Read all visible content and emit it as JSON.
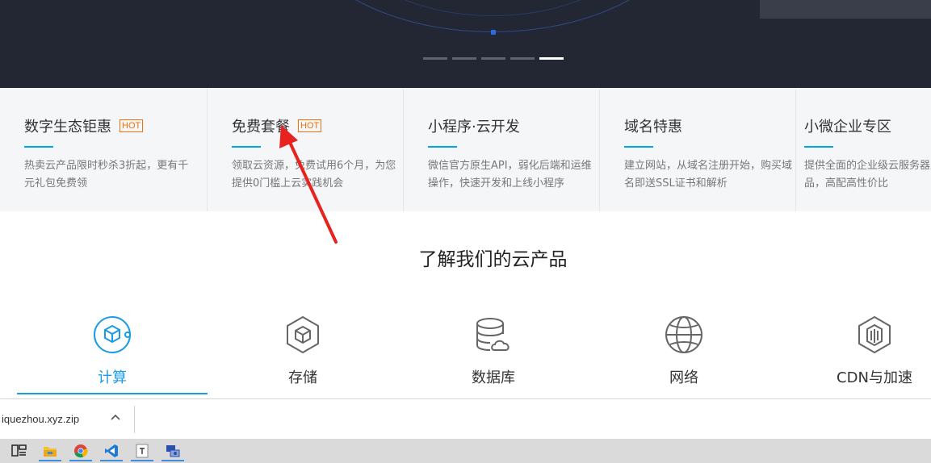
{
  "promo_cards": [
    {
      "title": "数字生态钜惠",
      "badge": "HOT",
      "desc": "热卖云产品限时秒杀3折起，更有千元礼包免费领"
    },
    {
      "title": "免费套餐",
      "badge": "HOT",
      "desc": "领取云资源，免费试用6个月，为您提供0门槛上云实践机会"
    },
    {
      "title": "小程序·云开发",
      "badge": "",
      "desc": "微信官方原生API，弱化后端和运维操作，快速开发和上线小程序"
    },
    {
      "title": "域名特惠",
      "badge": "",
      "desc": "建立网站，从域名注册开始，购买域名即送SSL证书和解析"
    },
    {
      "title": "小微企业专区",
      "badge": "",
      "desc": "提供全面的企业级云服务器及产品，高配高性价比"
    }
  ],
  "section": {
    "title": "了解我们的云产品"
  },
  "products": [
    {
      "label": "计算",
      "icon": "compute-icon",
      "active": true
    },
    {
      "label": "存储",
      "icon": "storage-icon",
      "active": false
    },
    {
      "label": "数据库",
      "icon": "database-icon",
      "active": false
    },
    {
      "label": "网络",
      "icon": "network-icon",
      "active": false
    },
    {
      "label": "CDN与加速",
      "icon": "cdn-icon",
      "active": false
    }
  ],
  "download_bar": {
    "filename": "iquezhou.xyz.zip"
  },
  "carousel": {
    "count": 5,
    "active_index": 4
  },
  "colors": {
    "accent": "#1a9be6",
    "hot": "#f56e0a",
    "banner_bg": "#232733",
    "annotation": "#e8231f"
  },
  "taskbar": {
    "items": [
      "task-view-icon",
      "file-explorer-icon",
      "chrome-icon",
      "vscode-icon",
      "typora-icon",
      "remote-desktop-icon"
    ]
  }
}
